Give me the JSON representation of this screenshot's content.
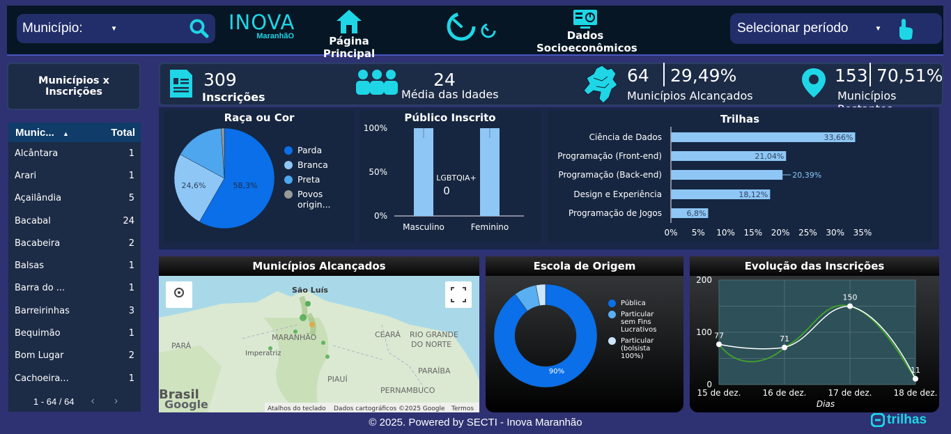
{
  "header": {
    "municipio_label": "Município:",
    "logo_line1": "INOVA",
    "logo_line2": "MaranhãO",
    "home_label": "Página Principal",
    "socio_label_1": "Dados",
    "socio_label_2": "Socioeconômicos",
    "period_label": "Selecionar período"
  },
  "sidebar": {
    "button_label": "Municípios x Inscrições",
    "table": {
      "col_name": "Munic...",
      "col_total": "Total",
      "rows": [
        {
          "name": "Alcântara",
          "total": "1"
        },
        {
          "name": "Arari",
          "total": "1"
        },
        {
          "name": "Açailândia",
          "total": "5"
        },
        {
          "name": "Bacabal",
          "total": "24"
        },
        {
          "name": "Bacabeira",
          "total": "2"
        },
        {
          "name": "Balsas",
          "total": "1"
        },
        {
          "name": "Barra do ...",
          "total": "1"
        },
        {
          "name": "Barreirinhas",
          "total": "3"
        },
        {
          "name": "Bequimão",
          "total": "1"
        },
        {
          "name": "Bom Lugar",
          "total": "2"
        },
        {
          "name": "Cachoeira...",
          "total": "1"
        }
      ],
      "pagination": "1 - 64 / 64"
    }
  },
  "kpis": {
    "inscricoes_value": "309",
    "inscricoes_label": "Inscrições",
    "idade_value": "24",
    "idade_label": "Média das Idades",
    "alcancados_value": "64",
    "alcancados_pct": "29,49%",
    "alcancados_label": "Municípios Alcançados",
    "restantes_value": "153",
    "restantes_pct": "70,51%",
    "restantes_label": "Municípios Restantes"
  },
  "raca": {
    "title": "Raça ou Cor",
    "label_parda": "58,3%",
    "label_branca": "24,6%",
    "legend": [
      "Parda",
      "Branca",
      "Preta",
      "Povos",
      "origin..."
    ]
  },
  "publico": {
    "title": "Público Inscrito",
    "y_ticks": [
      "100%",
      "50%",
      "0%"
    ],
    "categories": [
      "Masculino",
      "Feminino"
    ],
    "inner_label": "LGBTQIA+",
    "inner_value": "0"
  },
  "trilhas": {
    "title": "Trilhas",
    "x_ticks": [
      "0%",
      "5%",
      "10%",
      "15%",
      "20%",
      "25%",
      "30%",
      "35%"
    ]
  },
  "mapa": {
    "title": "Municípios Alcançados",
    "places": [
      "São Luís",
      "MARANHÃO",
      "CEARÁ",
      "RIO GRANDE",
      "DO NORTE",
      "PARÁ",
      "PARAÍBA",
      "PIAUÍ",
      "PERNAMBUCO",
      "Imperatriz",
      "Brasil"
    ],
    "brand": "Google",
    "attribution": [
      "Atalhos do teclado",
      "Dados cartográficos ©2025 Google",
      "Termos"
    ]
  },
  "escola": {
    "title": "Escola de Origem",
    "center_label": "90%",
    "legend": [
      "Pública",
      "Particular",
      "sem Fins",
      "Lucrativos",
      "Particular",
      "(bolsista",
      "100%)"
    ]
  },
  "evolucao": {
    "title": "Evolução das Inscrições",
    "x_title": "Dias",
    "y_ticks": [
      "200",
      "100",
      "0"
    ]
  },
  "footer": {
    "text": "© 2025. Powered by SECTI - Inova Maranhão",
    "brand": "trilhas"
  },
  "colors": {
    "background": "#2e3272",
    "panel": "#1c2b46",
    "accent_cyan": "#1fd6e6",
    "blue": "#0a6fe8",
    "light_blue": "#8ec7f5",
    "green_line": "#3f9e2f"
  },
  "chart_data": [
    {
      "type": "pie",
      "title": "Raça ou Cor",
      "categories": [
        "Parda",
        "Branca",
        "Preta",
        "Povos origin..."
      ],
      "values": [
        58.3,
        24.6,
        16.1,
        1.0
      ],
      "colors": [
        "#0a6fe8",
        "#8ec7f5",
        "#4ea6ee",
        "#9a9a9a"
      ]
    },
    {
      "type": "bar",
      "title": "Público Inscrito",
      "categories": [
        "Masculino",
        "Feminino"
      ],
      "values": [
        100,
        100
      ],
      "ylim": [
        0,
        100
      ],
      "annotations": [
        {
          "label": "LGBTQIA+",
          "value": 0
        }
      ]
    },
    {
      "type": "bar",
      "orientation": "horizontal",
      "title": "Trilhas",
      "categories": [
        "Ciência de Dados",
        "Programação (Front-end)",
        "Programação (Back-end)",
        "Design e Experiência",
        "Programação de Jogos"
      ],
      "values": [
        33.66,
        21.04,
        20.39,
        18.12,
        6.8
      ],
      "value_labels": [
        "33,66%",
        "21,04%",
        "20,39%",
        "18,12%",
        "6,8%"
      ],
      "xlim": [
        0,
        35
      ]
    },
    {
      "type": "pie",
      "title": "Escola de Origem",
      "categories": [
        "Pública",
        "Particular sem Fins Lucrativos",
        "Particular (bolsista 100%)"
      ],
      "values": [
        90,
        7,
        3
      ],
      "colors": [
        "#0a6fe8",
        "#5aaef2",
        "#c9e6fb"
      ]
    },
    {
      "type": "line",
      "title": "Evolução das Inscrições",
      "xlabel": "Dias",
      "x": [
        "15 de dez.",
        "16 de dez.",
        "17 de dez.",
        "18 de dez."
      ],
      "series": [
        {
          "values": [
            77,
            71,
            150,
            11
          ]
        }
      ],
      "ylim": [
        0,
        200
      ],
      "grid": true
    }
  ]
}
